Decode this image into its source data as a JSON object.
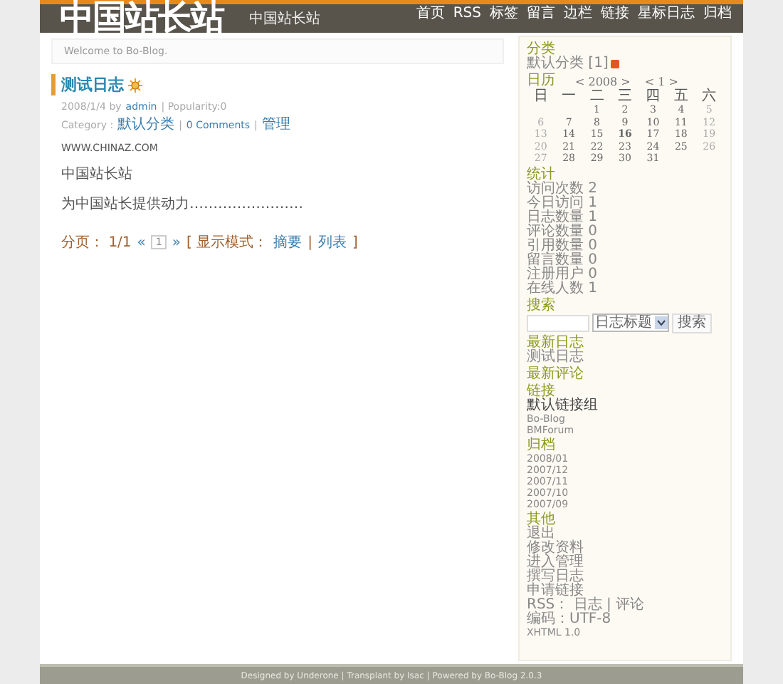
{
  "header": {
    "logo": "中国站长站",
    "subtitle": "中国站长站",
    "nav": [
      "首页",
      "RSS",
      "标签",
      "留言",
      "边栏",
      "链接",
      "星标日志",
      "归档"
    ]
  },
  "welcome": "Welcome to Bo-Blog.",
  "post": {
    "sep": "|",
    "title": "测试日志",
    "date": "2008/1/4",
    "by": "by",
    "author": "admin",
    "popularity": "Popularity:0",
    "category_label": "Category :",
    "category": "默认分类",
    "comments": "0 Comments",
    "manage": "管理",
    "body": [
      "WWW.CHINAZ.COM",
      "中国站长站",
      "为中国站长提供动力……………………"
    ]
  },
  "pagination": {
    "label": "分页：",
    "pages": "1/1",
    "prev": "«",
    "current": "1",
    "next": "»",
    "open": "[",
    "mode_label": "显示模式：",
    "modes": [
      "摘要",
      "列表"
    ],
    "sep": "|",
    "close": "]"
  },
  "sidebar": [
    {
      "kind": "category",
      "title": "分类",
      "items": [
        "默认分类 [1]"
      ]
    },
    {
      "kind": "calendar",
      "title": "日历",
      "year_nav": "< 2008 >",
      "month_nav": "< 1 >",
      "weekdays": [
        "日",
        "一",
        "二",
        "三",
        "四",
        "五",
        "六"
      ],
      "weeks": [
        [
          {
            "day": "1",
            "today": false
          },
          {
            "day": "2",
            "today": false
          },
          {
            "day": "3",
            "today": false
          },
          {
            "day": "4",
            "today": false
          },
          {
            "day": "5",
            "today": false
          }
        ],
        [
          {
            "day": "6",
            "today": false
          },
          {
            "day": "7",
            "today": false
          },
          {
            "day": "8",
            "today": false
          },
          {
            "day": "9",
            "today": false
          },
          {
            "day": "10",
            "today": false
          },
          {
            "day": "11",
            "today": false
          },
          {
            "day": "12",
            "today": false
          }
        ],
        [
          {
            "day": "13",
            "today": false
          },
          {
            "day": "14",
            "today": false
          },
          {
            "day": "15",
            "today": false
          },
          {
            "day": "16",
            "today": true
          },
          {
            "day": "17",
            "today": false
          },
          {
            "day": "18",
            "today": false
          },
          {
            "day": "19",
            "today": false
          }
        ],
        [
          {
            "day": "20",
            "today": false
          },
          {
            "day": "21",
            "today": false
          },
          {
            "day": "22",
            "today": false
          },
          {
            "day": "23",
            "today": false
          },
          {
            "day": "24",
            "today": false
          },
          {
            "day": "25",
            "today": false
          },
          {
            "day": "26",
            "today": false
          }
        ],
        [
          {
            "day": "27",
            "today": false
          },
          {
            "day": "28",
            "today": false
          },
          {
            "day": "29",
            "today": false
          },
          {
            "day": "30",
            "today": false
          },
          {
            "day": "31",
            "today": false
          }
        ]
      ]
    },
    {
      "kind": "list",
      "title": "统计",
      "items": [
        "访问次数 2",
        "今日访问 1",
        "日志数量 1",
        "评论数量 0",
        "引用数量 0",
        "留言数量 0",
        "注册用户 0",
        "在线人数 1"
      ]
    },
    {
      "kind": "search",
      "title": "搜索",
      "select": "日志标题",
      "button": "搜索"
    },
    {
      "kind": "list",
      "title": "最新日志",
      "items": [
        "测试日志"
      ]
    },
    {
      "kind": "list",
      "title": "最新评论"
    },
    {
      "kind": "links",
      "title": "链接",
      "items": [
        {
          "text": "默认链接组",
          "kind": "group"
        },
        {
          "text": "Bo-Blog",
          "kind": "link"
        },
        {
          "text": "BMForum",
          "kind": "link"
        }
      ]
    },
    {
      "kind": "list",
      "title": "归档",
      "items": [
        "2008/01",
        "2007/12",
        "2007/11",
        "2007/10",
        "2007/09"
      ]
    },
    {
      "kind": "list",
      "title": "其他",
      "items": [
        "退出",
        "修改资料",
        "进入管理",
        "撰写日志",
        "申请链接",
        "RSS： 日志 | 评论",
        "编码：UTF-8",
        "XHTML 1.0"
      ]
    }
  ],
  "footer": "Designed by Underone | Transplant by Isac | Powered by Bo-Blog 2.0.3"
}
